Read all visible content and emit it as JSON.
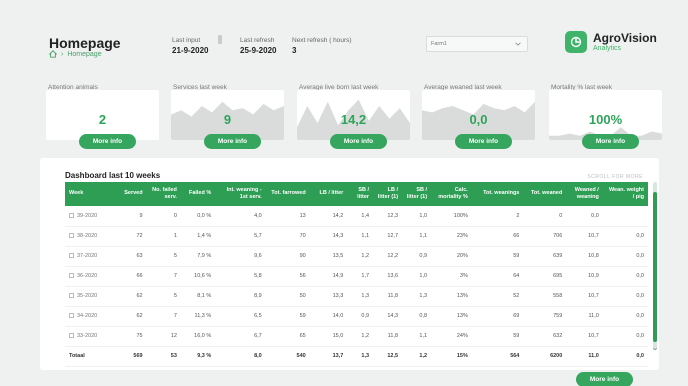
{
  "header": {
    "title": "Homepage",
    "breadcrumb": "Homepage",
    "last_input_label": "Last input",
    "last_input_value": "21-9-2020",
    "last_refresh_label": "Last refresh",
    "last_refresh_value": "25-9-2020",
    "next_refresh_label": "Next refresh ( hours)",
    "next_refresh_value": "3",
    "select_value": "Farm1"
  },
  "logo": {
    "name": "AgroVision",
    "sub": "Analytics"
  },
  "kpis": [
    {
      "title": "Attention animals",
      "value": "2",
      "button": "More info",
      "spark": []
    },
    {
      "title": "Services last week",
      "value": "9",
      "button": "More info",
      "spark": [
        0.6,
        0.7,
        0.55,
        0.8,
        0.65,
        0.9,
        0.7,
        0.75,
        0.6,
        0.85,
        0.7,
        0.8
      ]
    },
    {
      "title": "Average live born last week",
      "value": "14,2",
      "button": "More info",
      "spark": [
        0.3,
        0.8,
        0.4,
        0.9,
        0.35,
        0.7,
        0.95,
        0.45,
        0.8,
        0.5,
        0.75,
        0.4
      ]
    },
    {
      "title": "Average weaned last week",
      "value": "0,0",
      "button": "More info",
      "spark": [
        0.7,
        0.65,
        0.75,
        0.8,
        0.7,
        0.6,
        0.85,
        0.75,
        0.7,
        0.8,
        0.65,
        0.9
      ]
    },
    {
      "title": "Mortality % last week",
      "value": "100%",
      "button": "More info",
      "spark": [
        0.1,
        0.1,
        0.15,
        0.1,
        0.2,
        0.1,
        0.1,
        0.3,
        0.1,
        0.1,
        0.2,
        0.15
      ]
    }
  ],
  "table": {
    "title": "Dashboard last 10 weeks",
    "scroll_hint": "SCROLL FOR MORE",
    "columns": [
      "Week",
      "Served",
      "No. failed serv.",
      "Failed %",
      "Int. weaning - 1st serv.",
      "Tot. farrowed",
      "LB / litter",
      "SB / litter",
      "LB / litter (1)",
      "SB / litter (1)",
      "Calc. mortality %",
      "Tot. weanings",
      "Tot. weaned",
      "Weaned / weaning",
      "Wean. weight / pig"
    ],
    "rows": [
      [
        "39-2020",
        "9",
        "0",
        "0,0 %",
        "4,0",
        "13",
        "14,2",
        "1,4",
        "12,3",
        "1,0",
        "100%",
        "2",
        "0",
        "0,0",
        ""
      ],
      [
        "38-2020",
        "72",
        "1",
        "1,4 %",
        "5,7",
        "70",
        "14,3",
        "1,1",
        "12,7",
        "1,1",
        "23%",
        "66",
        "706",
        "10,7",
        "0,0"
      ],
      [
        "37-2020",
        "63",
        "5",
        "7,9 %",
        "9,6",
        "90",
        "13,5",
        "1,2",
        "12,2",
        "0,9",
        "20%",
        "59",
        "639",
        "10,8",
        "0,0"
      ],
      [
        "36-2020",
        "66",
        "7",
        "10,6 %",
        "5,8",
        "56",
        "14,9",
        "1,7",
        "13,6",
        "1,0",
        "3%",
        "64",
        "695",
        "10,9",
        "0,0"
      ],
      [
        "35-2020",
        "62",
        "5",
        "8,1 %",
        "8,9",
        "50",
        "13,3",
        "1,3",
        "11,8",
        "1,3",
        "13%",
        "52",
        "558",
        "10,7",
        "0,0"
      ],
      [
        "34-2020",
        "62",
        "7",
        "11,3 %",
        "6,5",
        "59",
        "14,0",
        "0,9",
        "14,3",
        "0,8",
        "13%",
        "69",
        "759",
        "11,0",
        "0,0"
      ],
      [
        "33-2020",
        "75",
        "12",
        "16,0 %",
        "6,7",
        "65",
        "15,0",
        "1,2",
        "11,8",
        "1,1",
        "24%",
        "59",
        "632",
        "10,7",
        "0,0"
      ]
    ],
    "total": [
      "Totaal",
      "569",
      "53",
      "9,3 %",
      "8,0",
      "540",
      "13,7",
      "1,3",
      "12,5",
      "1,2",
      "15%",
      "564",
      "6200",
      "11,0",
      "0,0"
    ]
  },
  "bottom_button": "More info"
}
